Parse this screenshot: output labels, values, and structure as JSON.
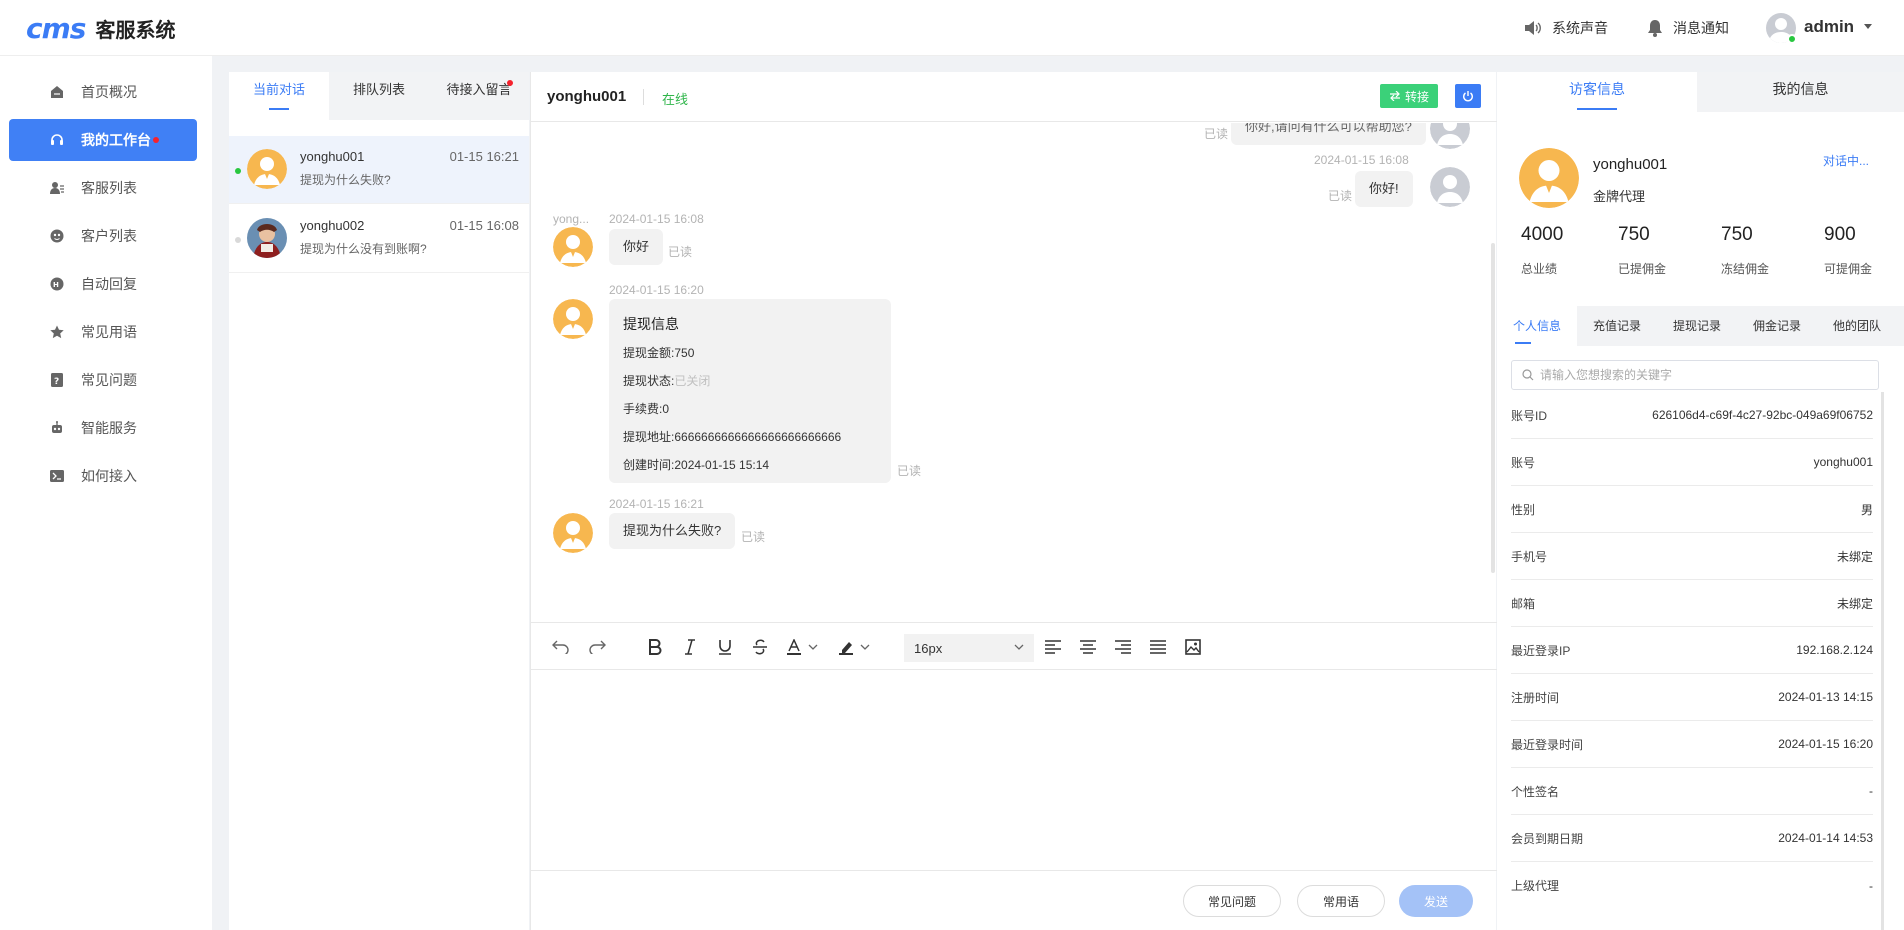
{
  "header": {
    "logo_mark": "cms",
    "app_name": "客服系统",
    "sound_label": "系统声音",
    "notify_label": "消息通知",
    "user_name": "admin"
  },
  "sidebar": {
    "items": [
      {
        "label": "首页概况",
        "icon": "home-icon"
      },
      {
        "label": "我的工作台",
        "icon": "headset-icon",
        "active": true,
        "badge": true
      },
      {
        "label": "客服列表",
        "icon": "agent-icon"
      },
      {
        "label": "客户列表",
        "icon": "customer-icon"
      },
      {
        "label": "自动回复",
        "icon": "auto-reply-icon"
      },
      {
        "label": "常见用语",
        "icon": "star-icon"
      },
      {
        "label": "常见问题",
        "icon": "question-icon"
      },
      {
        "label": "智能服务",
        "icon": "robot-icon"
      },
      {
        "label": "如何接入",
        "icon": "terminal-icon"
      }
    ]
  },
  "conversations": {
    "tabs": [
      "当前对话",
      "排队列表",
      "待接入留言"
    ],
    "items": [
      {
        "name": "yonghu001",
        "time": "01-15 16:21",
        "last": "提现为什么失败?",
        "online": true
      },
      {
        "name": "yonghu002",
        "time": "01-15 16:08",
        "last": "提现为什么没有到账啊?",
        "online": false
      }
    ]
  },
  "chat": {
    "user": "yonghu001",
    "status": "在线",
    "transfer_label": "转接",
    "messages": {
      "top_partial_text": "你好,请问有什么可以帮助您?",
      "top_partial_read": "已读",
      "m1_time": "2024-01-15 16:08",
      "m1_text": "你好!",
      "m1_read": "已读",
      "m2_sender": "yong...",
      "m2_time": "2024-01-15 16:08",
      "m2_text": "你好",
      "m2_read": "已读",
      "m3_time": "2024-01-15 16:20",
      "card": {
        "title": "提现信息",
        "amount_label": "提现金额:",
        "amount": "750",
        "status_label": "提现状态:",
        "status": "已关闭",
        "fee_label": "手续费:",
        "fee": "0",
        "address_label": "提现地址:",
        "address": "6666666666666666666666666",
        "created_label": "创建时间:",
        "created": "2024-01-15 15:14"
      },
      "m3_read": "已读",
      "m4_time": "2024-01-15 16:21",
      "m4_text": "提现为什么失败?",
      "m4_read": "已读"
    },
    "font_size": "16px",
    "faq_label": "常见问题",
    "phrases_label": "常用语",
    "send_label": "发送"
  },
  "visitor": {
    "tabs": [
      "访客信息",
      "我的信息"
    ],
    "name": "yonghu001",
    "level": "金牌代理",
    "in_chat": "对话中...",
    "stats": [
      {
        "value": "4000",
        "label": "总业绩"
      },
      {
        "value": "750",
        "label": "已提佣金"
      },
      {
        "value": "750",
        "label": "冻结佣金"
      },
      {
        "value": "900",
        "label": "可提佣金"
      }
    ],
    "sub_tabs": [
      "个人信息",
      "充值记录",
      "提现记录",
      "佣金记录",
      "他的团队"
    ],
    "search_placeholder": "请输入您想搜索的关键字",
    "info": [
      {
        "k": "账号ID",
        "v": "626106d4-c69f-4c27-92bc-049a69f06752"
      },
      {
        "k": "账号",
        "v": "yonghu001"
      },
      {
        "k": "性别",
        "v": "男"
      },
      {
        "k": "手机号",
        "v": "未绑定"
      },
      {
        "k": "邮箱",
        "v": "未绑定"
      },
      {
        "k": "最近登录IP",
        "v": "192.168.2.124"
      },
      {
        "k": "注册时间",
        "v": "2024-01-13 14:15"
      },
      {
        "k": "最近登录时间",
        "v": "2024-01-15 16:20"
      },
      {
        "k": "个性签名",
        "v": "-"
      },
      {
        "k": "会员到期日期",
        "v": "2024-01-14 14:53"
      },
      {
        "k": "上级代理",
        "v": "-"
      }
    ]
  },
  "colors": {
    "accent": "#3b7cf5",
    "online": "#2fb54a",
    "transfer": "#3bd179",
    "badge": "#f5222d"
  }
}
